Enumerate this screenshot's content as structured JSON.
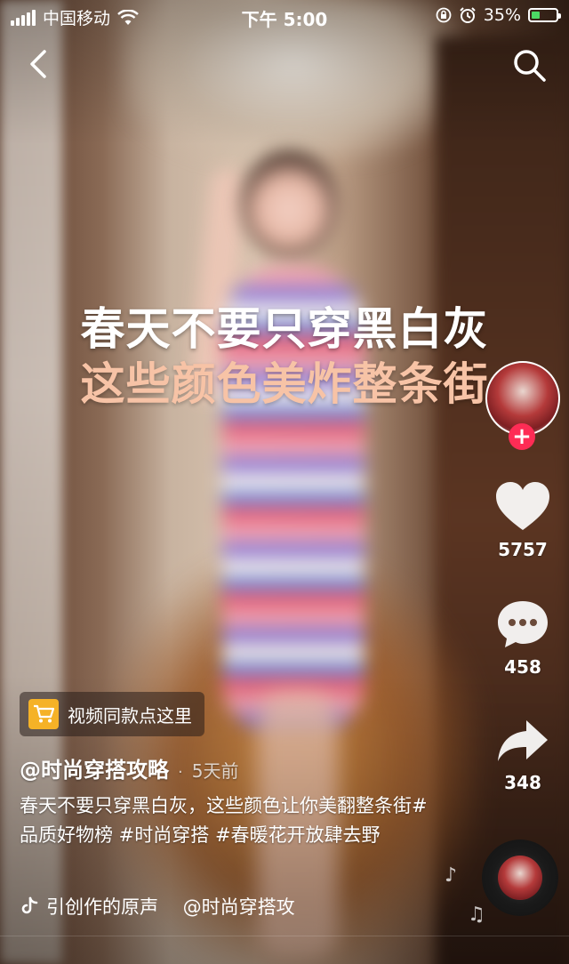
{
  "status_bar": {
    "carrier": "中国移动",
    "time": "下午 5:00",
    "battery_percent": "35%",
    "battery_level": 0.35,
    "icons": [
      "signal-icon",
      "wifi-icon",
      "orientation-lock-icon",
      "alarm-icon",
      "battery-icon"
    ]
  },
  "nav": {
    "back_icon": "back-chevron-icon",
    "search_icon": "search-icon"
  },
  "overlay_caption": {
    "line1": "春天不要只穿黑白灰",
    "line2": "这些颜色美炸整条街",
    "line2_color": "#f7c3a6"
  },
  "right_rail": {
    "follow_label": "+",
    "follow_color": "#fe2c55",
    "likes": "5757",
    "comments": "458",
    "shares": "348"
  },
  "product_tag": {
    "label": "视频同款点这里",
    "icon": "cart-icon",
    "icon_color": "#f5b227"
  },
  "post": {
    "author": "@时尚穿搭攻略",
    "separator": "·",
    "posted": "5天前",
    "description": "春天不要只穿黑白灰，这些颜色让你美翻整条街#品质好物榜 #时尚穿搭 #春暖花开放肆去野"
  },
  "music": {
    "text": "引创作的原声　 @时尚穿搭攻",
    "icon": "tiktok-note-icon"
  },
  "float_notes": [
    "♪",
    "♫"
  ]
}
